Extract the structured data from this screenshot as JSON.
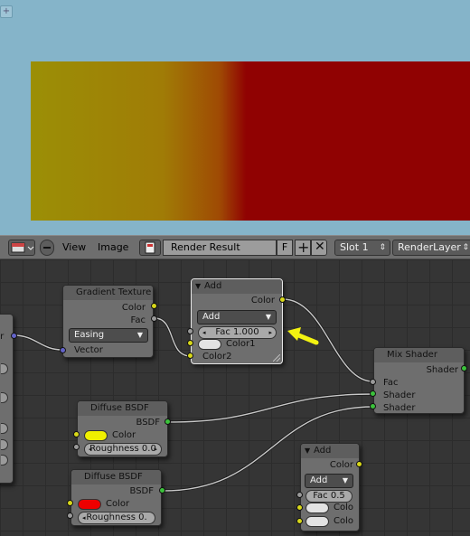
{
  "header": {
    "view_label": "View",
    "image_label": "Image",
    "image_name": "Render Result",
    "fake_user_label": "F",
    "slot": "Slot 1",
    "layer": "RenderLayer"
  },
  "nodes": {
    "gradient_texture": {
      "title": "Gradient Texture",
      "out_color": "Color",
      "out_fac": "Fac",
      "type": "Easing",
      "in_vector": "Vector"
    },
    "add_main": {
      "title": "Add",
      "out_color": "Color",
      "mode": "Add",
      "fac": "Fac 1.000",
      "color1": "Color1",
      "color2": "Color2"
    },
    "mix_shader": {
      "title": "Mix Shader",
      "out_shader": "Shader",
      "in_fac": "Fac",
      "in_shader1": "Shader",
      "in_shader2": "Shader"
    },
    "diffuse_yellow": {
      "title": "Diffuse BSDF",
      "out_bsdf": "BSDF",
      "color_label": "Color",
      "roughness": "Roughness 0.0",
      "swatch": "#f0f000"
    },
    "diffuse_red": {
      "title": "Diffuse BSDF",
      "out_bsdf": "BSDF",
      "color_label": "Color",
      "roughness": "Roughness 0.",
      "swatch": "#ee0000"
    },
    "add_small": {
      "title": "Add",
      "out_color": "Color",
      "mode": "Add",
      "fac": "Fac 0.5",
      "color1": "Colo",
      "color2": "Colo"
    },
    "left_partial": {
      "out_label": "or"
    }
  },
  "colors": {
    "viewer_bg": "#85b4c9",
    "render_yellow": "#9b8f06",
    "render_red": "#900202",
    "arrow": "#f2f211"
  }
}
